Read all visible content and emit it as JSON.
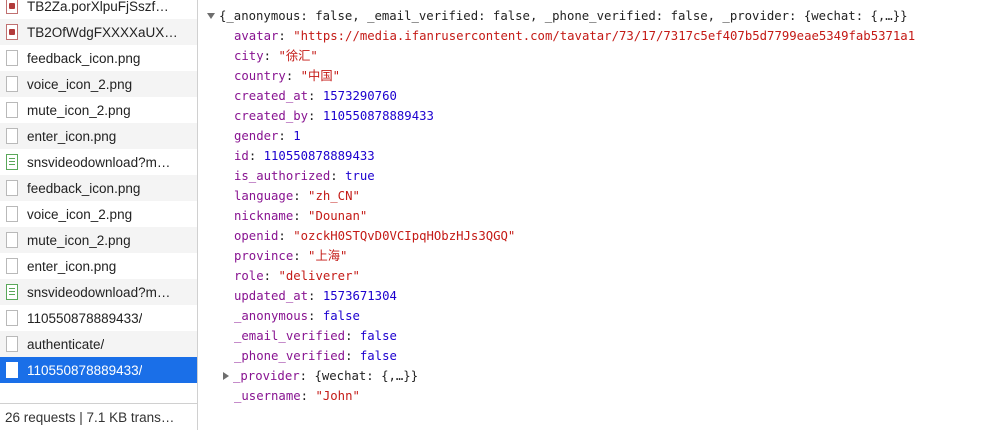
{
  "requests": [
    {
      "name": "TB2Za.porXlpuFjSszf…",
      "icon": "image-file-icon",
      "type": "img",
      "alt": false
    },
    {
      "name": "TB2OfWdgFXXXXaUX…",
      "icon": "image-file-icon",
      "type": "img",
      "alt": true
    },
    {
      "name": "feedback_icon.png",
      "icon": "file-icon",
      "type": "doc",
      "alt": false
    },
    {
      "name": "voice_icon_2.png",
      "icon": "file-icon",
      "type": "doc",
      "alt": true
    },
    {
      "name": "mute_icon_2.png",
      "icon": "file-icon",
      "type": "doc",
      "alt": false
    },
    {
      "name": "enter_icon.png",
      "icon": "file-icon",
      "type": "doc",
      "alt": true
    },
    {
      "name": "snsvideodownload?m…",
      "icon": "media-file-icon",
      "type": "media",
      "alt": false
    },
    {
      "name": "feedback_icon.png",
      "icon": "file-icon",
      "type": "doc",
      "alt": true
    },
    {
      "name": "voice_icon_2.png",
      "icon": "file-icon",
      "type": "doc",
      "alt": false
    },
    {
      "name": "mute_icon_2.png",
      "icon": "file-icon",
      "type": "doc",
      "alt": true
    },
    {
      "name": "enter_icon.png",
      "icon": "file-icon",
      "type": "doc",
      "alt": false
    },
    {
      "name": "snsvideodownload?m…",
      "icon": "media-file-icon",
      "type": "media",
      "alt": true
    },
    {
      "name": "110550878889433/",
      "icon": "file-icon",
      "type": "doc",
      "alt": false
    },
    {
      "name": "authenticate/",
      "icon": "file-icon",
      "type": "doc",
      "alt": true
    },
    {
      "name": "110550878889433/",
      "icon": "file-icon",
      "type": "doc",
      "alt": false,
      "selected": true
    }
  ],
  "status_bar": "26 requests | 7.1 KB trans…",
  "preview": {
    "summary": "{_anonymous: false, _email_verified: false, _phone_verified: false, _provider: {wechat: {,…}}",
    "fields": [
      {
        "key": "avatar",
        "value": "\"https://media.ifanrusercontent.com/tavatar/73/17/7317c5ef407b5d7799eae5349fab5371a1",
        "kind": "str"
      },
      {
        "key": "city",
        "value": "\"徐汇\"",
        "kind": "str"
      },
      {
        "key": "country",
        "value": "\"中国\"",
        "kind": "str"
      },
      {
        "key": "created_at",
        "value": "1573290760",
        "kind": "num"
      },
      {
        "key": "created_by",
        "value": "110550878889433",
        "kind": "num"
      },
      {
        "key": "gender",
        "value": "1",
        "kind": "num"
      },
      {
        "key": "id",
        "value": "110550878889433",
        "kind": "num"
      },
      {
        "key": "is_authorized",
        "value": "true",
        "kind": "kw"
      },
      {
        "key": "language",
        "value": "\"zh_CN\"",
        "kind": "str"
      },
      {
        "key": "nickname",
        "value": "\"Dounan\"",
        "kind": "str"
      },
      {
        "key": "openid",
        "value": "\"ozckH0STQvD0VCIpqHObzHJs3QGQ\"",
        "kind": "str"
      },
      {
        "key": "province",
        "value": "\"上海\"",
        "kind": "str"
      },
      {
        "key": "role",
        "value": "\"deliverer\"",
        "kind": "str"
      },
      {
        "key": "updated_at",
        "value": "1573671304",
        "kind": "num"
      },
      {
        "key": "_anonymous",
        "value": "false",
        "kind": "kw"
      },
      {
        "key": "_email_verified",
        "value": "false",
        "kind": "kw"
      },
      {
        "key": "_phone_verified",
        "value": "false",
        "kind": "kw"
      },
      {
        "key": "_provider",
        "value": "{wechat: {,…}}",
        "kind": "plain",
        "expandable": true
      },
      {
        "key": "_username",
        "value": "\"John\"",
        "kind": "str"
      }
    ]
  },
  "colors": {
    "selected_row": "#1a6fe8",
    "key": "#881391",
    "string": "#c41a16",
    "number": "#1c00cf"
  }
}
